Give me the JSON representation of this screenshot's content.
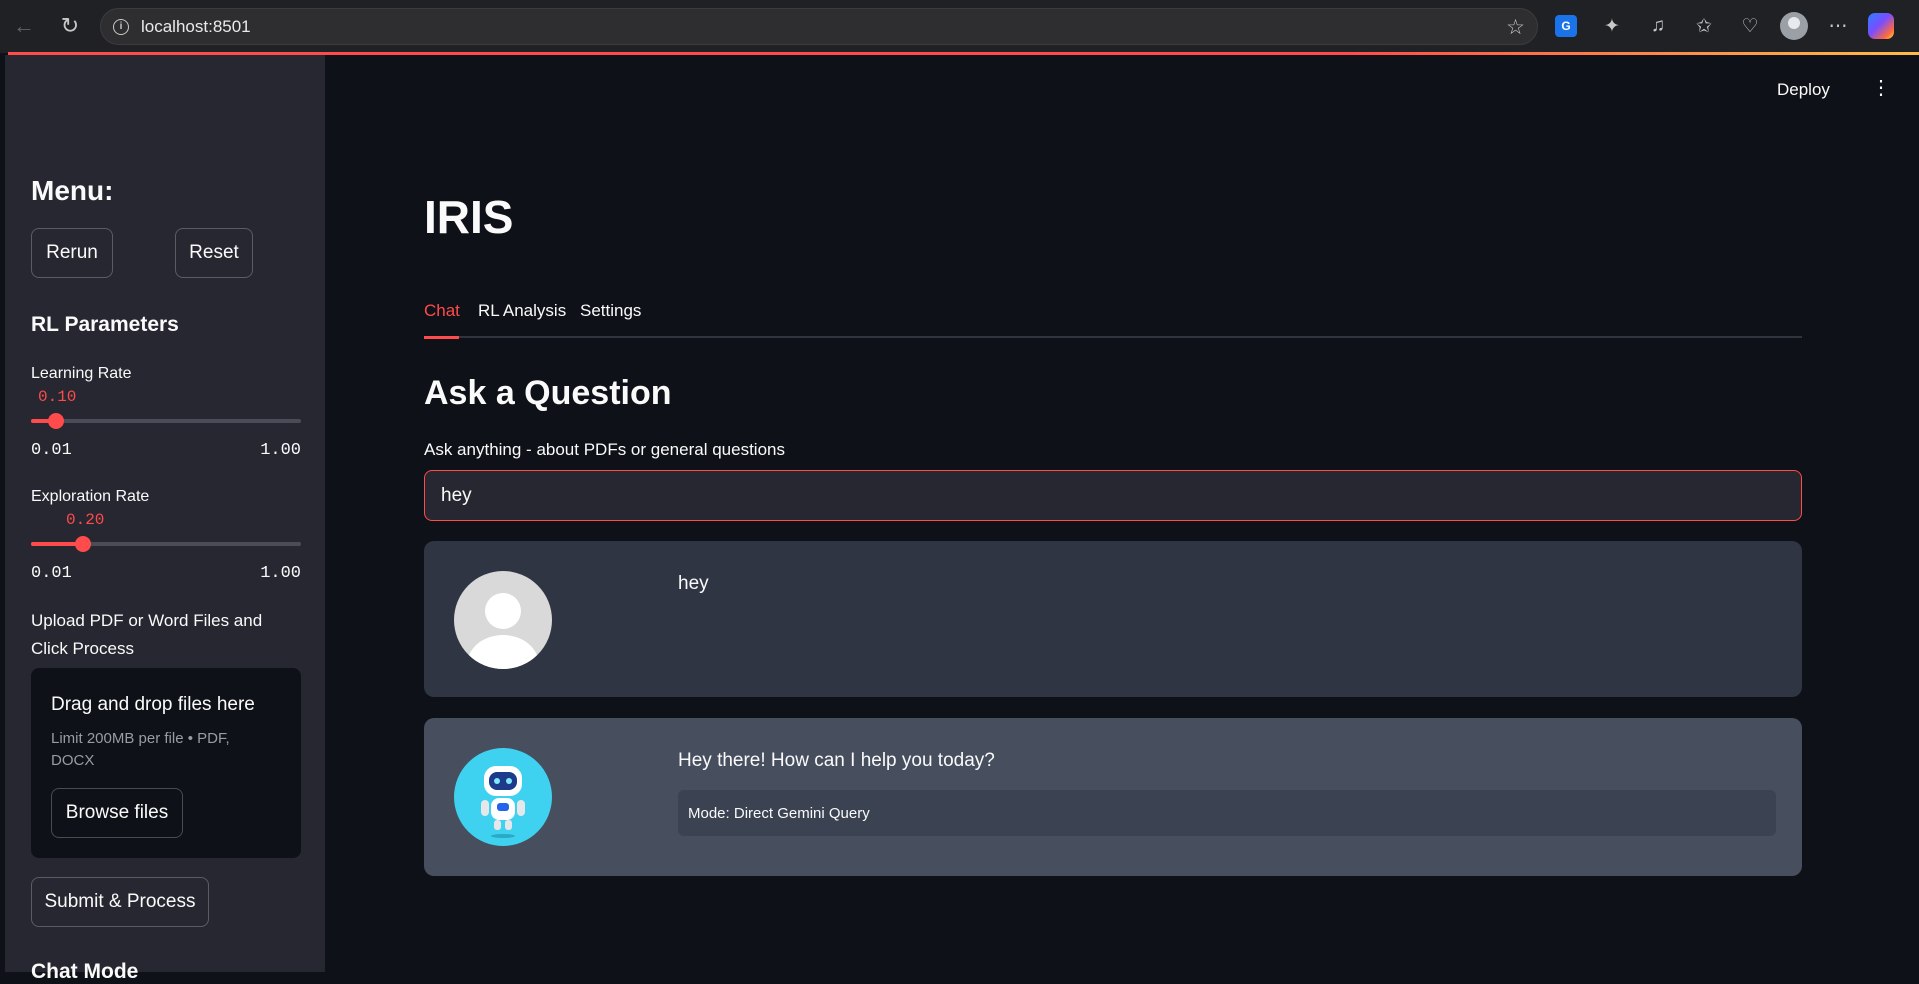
{
  "browser": {
    "url": "localhost:8501"
  },
  "header": {
    "deploy_label": "Deploy"
  },
  "sidebar": {
    "menu_title": "Menu:",
    "rerun_label": "Rerun",
    "reset_label": "Reset",
    "rl_title": "RL Parameters",
    "learning_rate": {
      "label": "Learning Rate",
      "value": "0.10",
      "min": "0.01",
      "max": "1.00",
      "fraction": 0.091
    },
    "exploration_rate": {
      "label": "Exploration Rate",
      "value": "0.20",
      "min": "0.01",
      "max": "1.00",
      "fraction": 0.192
    },
    "upload_label": "Upload PDF or Word Files and Click Process",
    "dropzone_title": "Drag and drop files here",
    "dropzone_sub": "Limit 200MB per file • PDF, DOCX",
    "browse_label": "Browse files",
    "submit_label": "Submit & Process",
    "next_section_partial": "Chat Mode"
  },
  "main": {
    "title": "IRIS",
    "tabs": [
      "Chat",
      "RL Analysis",
      "Settings"
    ],
    "active_tab": 0,
    "section_title": "Ask a Question",
    "input_label": "Ask anything - about PDFs or general questions",
    "input_value": "hey",
    "messages": [
      {
        "role": "user",
        "text": "hey"
      },
      {
        "role": "assistant",
        "text": "Hey there! How can I help you today?",
        "mode": "Mode: Direct Gemini Query"
      }
    ]
  },
  "colors": {
    "accent": "#ff4b4b",
    "bg": "#0e1117",
    "sidebar_bg": "#262730"
  }
}
